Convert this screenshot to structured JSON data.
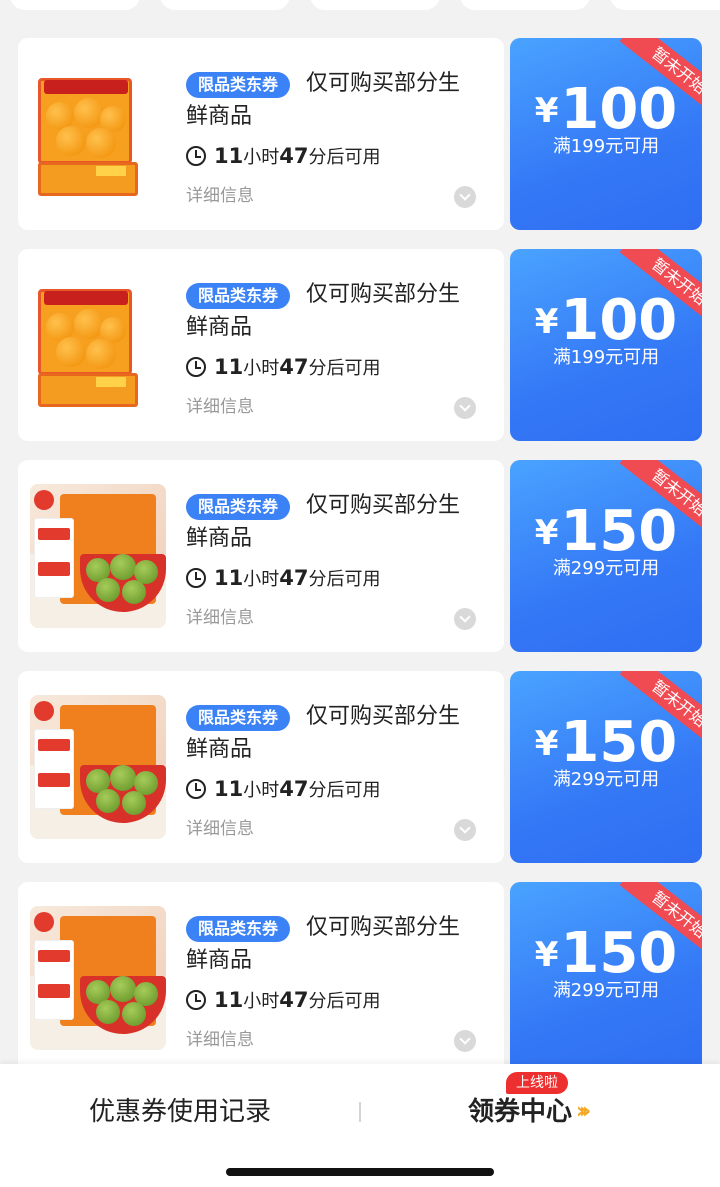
{
  "coupons": [
    {
      "product": "orange-box",
      "badge": "限品类东券",
      "title_line1": "仅可购买部分生",
      "title_line2": "鲜商品",
      "timer_hours": "11",
      "timer_hours_unit": "小时",
      "timer_minutes": "47",
      "timer_suffix": "分后可用",
      "detail": "详细信息",
      "ribbon": "暂未开始",
      "currency": "¥",
      "amount": "100",
      "condition": "满199元可用"
    },
    {
      "product": "orange-box",
      "badge": "限品类东券",
      "title_line1": "仅可购买部分生",
      "title_line2": "鲜商品",
      "timer_hours": "11",
      "timer_hours_unit": "小时",
      "timer_minutes": "47",
      "timer_suffix": "分后可用",
      "detail": "详细信息",
      "ribbon": "暂未开始",
      "currency": "¥",
      "amount": "100",
      "condition": "满199元可用"
    },
    {
      "product": "noodle-bowl",
      "badge": "限品类东券",
      "title_line1": "仅可购买部分生",
      "title_line2": "鲜商品",
      "timer_hours": "11",
      "timer_hours_unit": "小时",
      "timer_minutes": "47",
      "timer_suffix": "分后可用",
      "detail": "详细信息",
      "ribbon": "暂未开始",
      "currency": "¥",
      "amount": "150",
      "condition": "满299元可用"
    },
    {
      "product": "noodle-bowl",
      "badge": "限品类东券",
      "title_line1": "仅可购买部分生",
      "title_line2": "鲜商品",
      "timer_hours": "11",
      "timer_hours_unit": "小时",
      "timer_minutes": "47",
      "timer_suffix": "分后可用",
      "detail": "详细信息",
      "ribbon": "暂未开始",
      "currency": "¥",
      "amount": "150",
      "condition": "满299元可用"
    },
    {
      "product": "noodle-bowl",
      "badge": "限品类东券",
      "title_line1": "仅可购买部分生",
      "title_line2": "鲜商品",
      "timer_hours": "11",
      "timer_hours_unit": "小时",
      "timer_minutes": "47",
      "timer_suffix": "分后可用",
      "detail": "详细信息",
      "ribbon": "暂未开始",
      "currency": "¥",
      "amount": "150",
      "condition": "满299元可用"
    }
  ],
  "bottom_bar": {
    "history_label": "优惠券使用记录",
    "center_label": "领券中心",
    "center_tag": "上线啦",
    "center_icon": "double-chevron-right-icon"
  },
  "colors": {
    "badge_blue": "#3b82f6",
    "coupon_blue": "#3478f6",
    "ribbon_red": "#f04a53",
    "arrow_orange": "#f5a623",
    "new_tag_red": "#ee2f2f"
  }
}
